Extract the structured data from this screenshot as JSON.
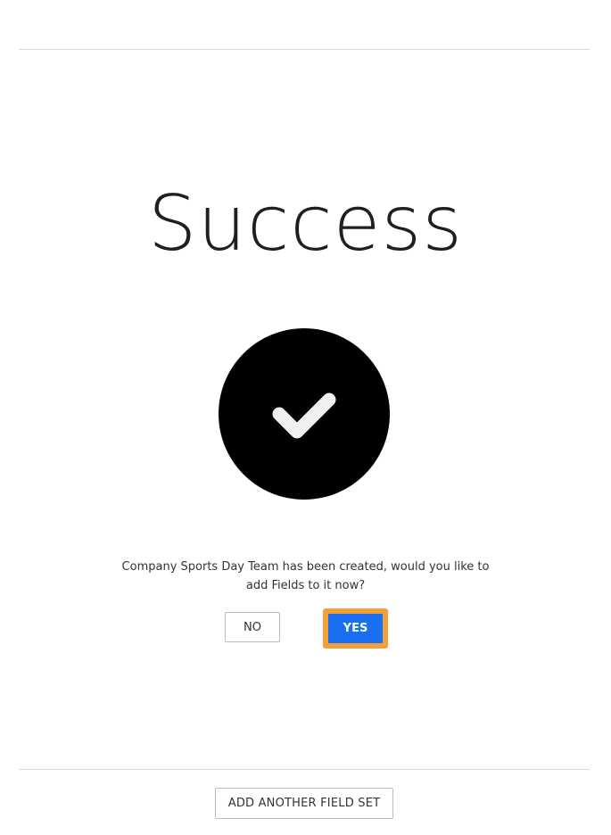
{
  "page": {
    "title": "Success",
    "message_line1": "Company Sports Day Team has been created, would you like to",
    "message_line2": "add Fields to it now?"
  },
  "actions": {
    "no_label": "NO",
    "yes_label": "YES",
    "add_field_set_label": "ADD ANOTHER FIELD SET"
  },
  "icons": {
    "success": "check-circle-icon"
  },
  "colors": {
    "primary": "#1a6ff0",
    "focus_ring": "#f4a03a",
    "icon_bg": "#000000",
    "icon_fg": "#f0f0f0"
  }
}
